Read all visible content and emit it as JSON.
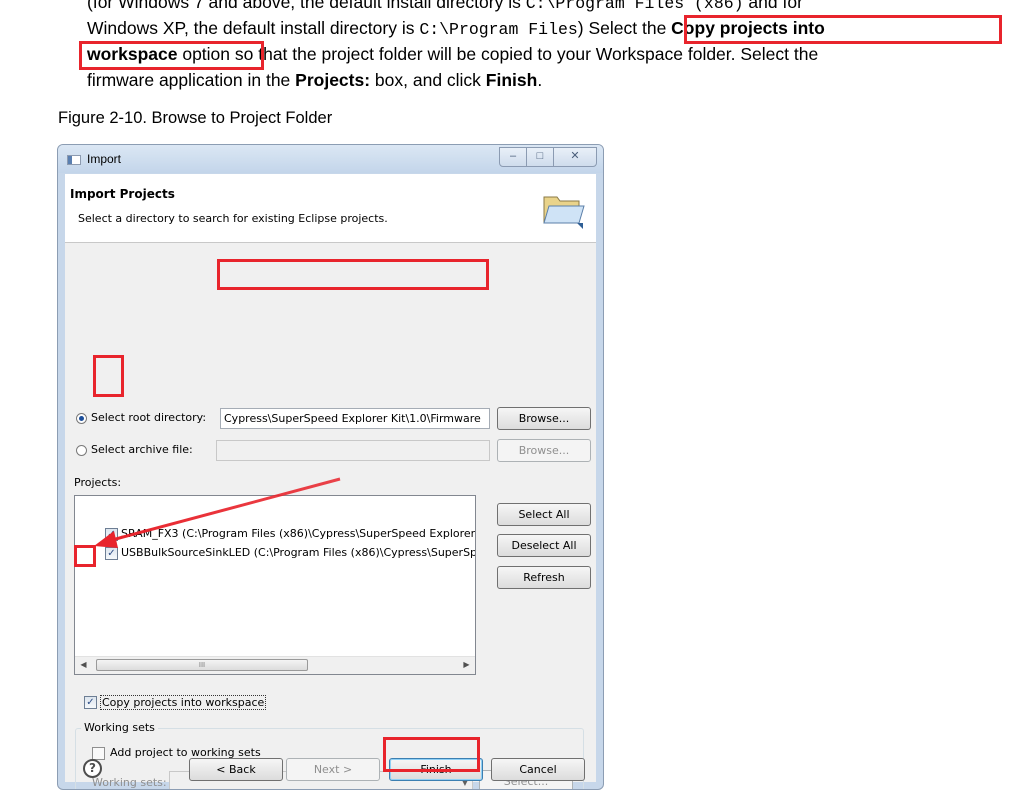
{
  "document": {
    "line1": {
      "a": "(for Windows 7 and above, the default install directory is ",
      "path": "C:\\Program Files (x86)",
      "b": " and for"
    },
    "line2": {
      "a": "Windows XP, the default install directory is ",
      "path": "C:\\Program Files",
      "b": ")",
      "c": " Select the ",
      "bold": "Copy projects into"
    },
    "line3": {
      "bold": "workspace",
      "a": " option",
      "b": " so that the project folder will be copied to your Workspace folder. Select the"
    },
    "line4": {
      "a": "firmware application in the ",
      "bold1": "Projects:",
      "b": " box, and click ",
      "bold2": "Finish",
      "c": "."
    },
    "figure_caption": "Figure 2-10.  Browse to Project Folder"
  },
  "dialog": {
    "title": "Import",
    "window_buttons": {
      "minimize": "–",
      "maximize": "□",
      "close": "✕"
    },
    "header_title": "Import Projects",
    "header_desc": "Select a directory to search for existing Eclipse projects.",
    "folder_icon": "open-folder-icon",
    "root_dir_label": "Select root directory:",
    "root_dir_value": "Cypress\\SuperSpeed Explorer Kit\\1.0\\Firmware",
    "browse_label": "Browse...",
    "archive_label": "Select archive file:",
    "archive_value": "",
    "browse2_label": "Browse...",
    "projects_label": "Projects:",
    "projects": [
      {
        "label": "SRAM_FX3 (C:\\Program Files (x86)\\Cypress\\SuperSpeed Explorer K",
        "checked": true
      },
      {
        "label": "USBBulkSourceSinkLED (C:\\Program Files (x86)\\Cypress\\SuperSpe",
        "checked": true
      }
    ],
    "select_all_label": "Select All",
    "deselect_all_label": "Deselect All",
    "refresh_label": "Refresh",
    "scrollbar": {
      "left": "◀",
      "right": "▶",
      "grip": "III"
    },
    "copy_projects_label": "Copy projects into workspace",
    "working_sets_group": "Working sets",
    "add_working_sets_label": "Add project to working sets",
    "working_sets_label": "Working sets:",
    "working_sets_value": "",
    "combo_arrow": "▼",
    "select_label": "Select...",
    "help_icon": "?",
    "back_label": "< Back",
    "next_label": "Next >",
    "finish_label": "Finish",
    "cancel_label": "Cancel"
  },
  "colors": {
    "highlight": "#e8242c",
    "dialog_frame": "#c7d7ea"
  }
}
